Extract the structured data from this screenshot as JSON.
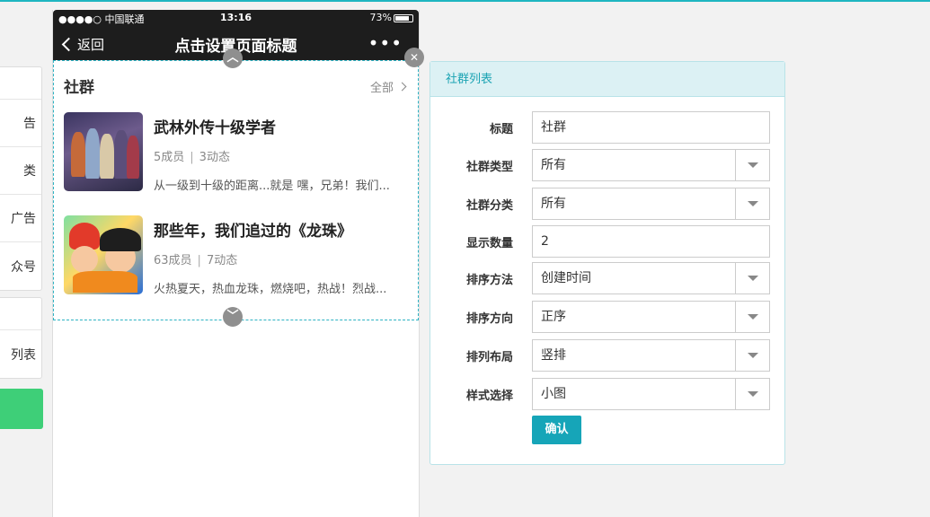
{
  "sidebar": {
    "group1_items": [
      "告",
      "类",
      "广告",
      "众号"
    ],
    "group2_items": [
      "列表"
    ]
  },
  "phone": {
    "status": {
      "carrier": "●●●●○ 中国联通 ",
      "time": "13:16",
      "battery": "73%"
    },
    "nav": {
      "back_label": "返回",
      "title": "点击设置页面标题",
      "more_label": "•••"
    },
    "module": {
      "title": "社群",
      "all_label": "全部",
      "items": [
        {
          "name": "武林外传十级学者",
          "members": "5成员",
          "posts": "3动态",
          "desc": "从一级到十级的距离...就是 嘿，兄弟！我们..."
        },
        {
          "name": "那些年，我们追过的《龙珠》",
          "members": "63成员",
          "posts": "7动态",
          "desc": "火热夏天，热血龙珠，燃烧吧，热战！烈战..."
        }
      ]
    }
  },
  "panel": {
    "title": "社群列表",
    "fields": [
      {
        "label": "标题",
        "value": "社群",
        "type": "text"
      },
      {
        "label": "社群类型",
        "value": "所有",
        "type": "select"
      },
      {
        "label": "社群分类",
        "value": "所有",
        "type": "select"
      },
      {
        "label": "显示数量",
        "value": "2",
        "type": "text"
      },
      {
        "label": "排序方法",
        "value": "创建时间",
        "type": "select"
      },
      {
        "label": "排序方向",
        "value": "正序",
        "type": "select"
      },
      {
        "label": "排列布局",
        "value": "竖排",
        "type": "select"
      },
      {
        "label": "样式选择",
        "value": "小图",
        "type": "select"
      }
    ],
    "confirm_label": "确认"
  },
  "colors": {
    "accent": "#16a5b8",
    "panel_header_bg": "#dcf1f4",
    "dashed_border": "#2eb3c4",
    "green": "#3ecf78"
  }
}
